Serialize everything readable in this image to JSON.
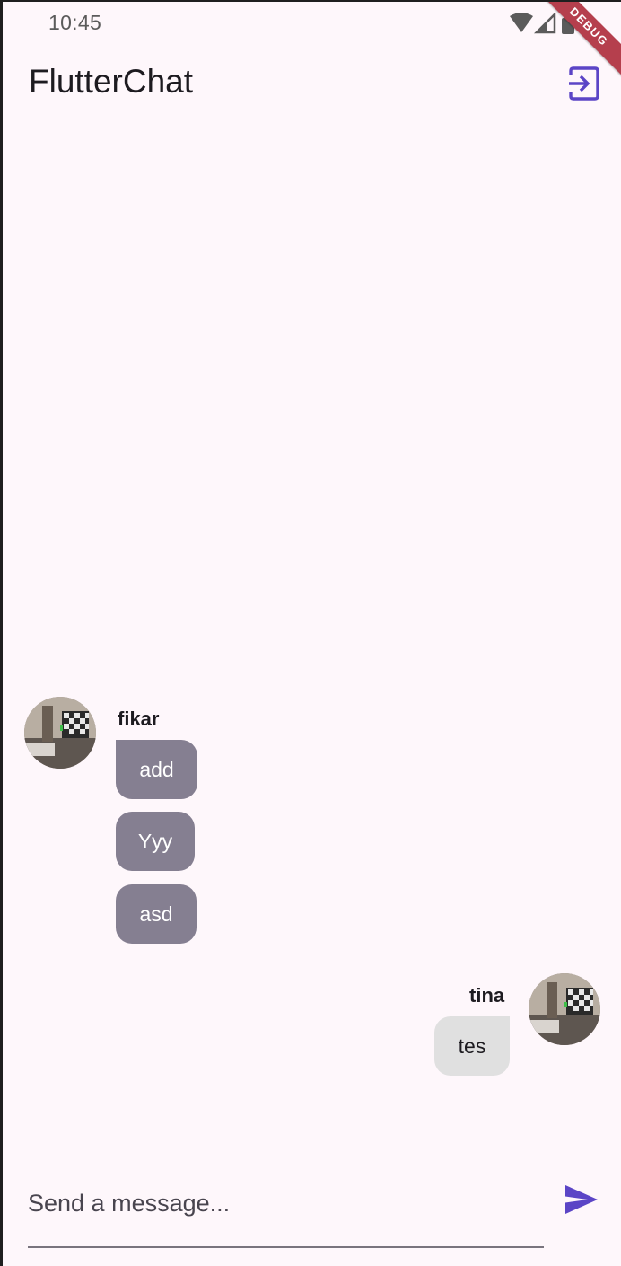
{
  "status_bar": {
    "time": "10:45",
    "debug_label": "DEBUG"
  },
  "app_bar": {
    "title": "FlutterChat",
    "exit_icon": "exit-to-app-icon"
  },
  "messages": {
    "fikar": {
      "username": "fikar",
      "bubbles": [
        "add",
        "Yyy",
        "asd"
      ]
    },
    "tina": {
      "username": "tina",
      "bubbles": [
        "tes"
      ]
    }
  },
  "composer": {
    "placeholder": "Send a message...",
    "value": "",
    "send_icon": "send-icon"
  },
  "colors": {
    "background": "#fef7fb",
    "accent": "#5b45c6",
    "other_bubble": "#857f91",
    "own_bubble": "#e0e0e0",
    "debug_banner": "#b53f4d"
  }
}
